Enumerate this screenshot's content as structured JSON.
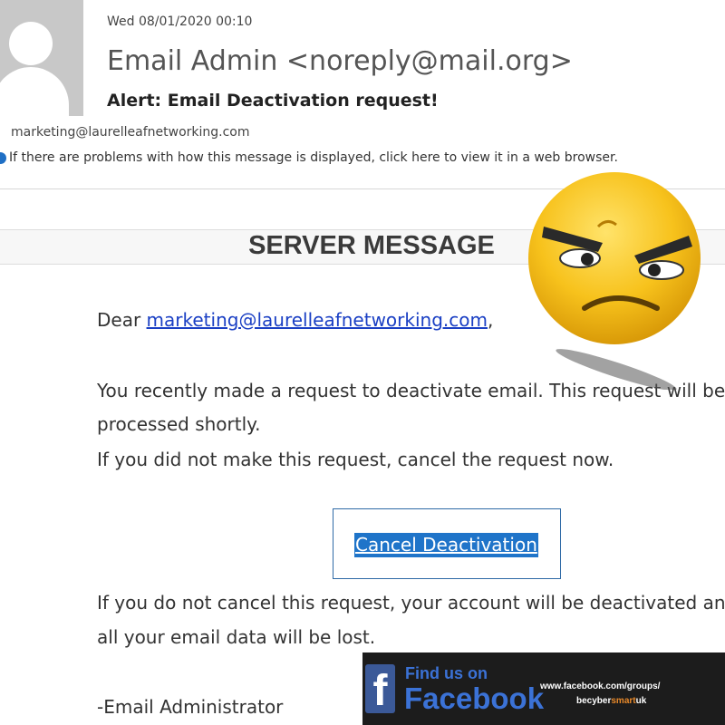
{
  "header": {
    "date": "Wed 08/01/2020 00:10",
    "from": "Email Admin <noreply@mail.org>",
    "subject": "Alert: Email Deactivation request!",
    "to": "marketing@laurelleafnetworking.com",
    "info_bar": "If there are problems with how this message is displayed, click here to view it in a web browser."
  },
  "message": {
    "band_title": "SERVER MESSAGE",
    "greeting_prefix": "Dear ",
    "greeting_email": "marketing@laurelleafnetworking.com",
    "greeting_suffix": ",",
    "para1_line1": "You recently made a request to deactivate email. This request will be",
    "para1_line2": "processed shortly.",
    "para2": "If you did not make this request, cancel the request now.",
    "cancel_label": "Cancel Deactivation",
    "warning_line1": "If you do not cancel this request, your account will be deactivated and",
    "warning_line2": "all your email data will be lost.",
    "signature": "-Email Administrator"
  },
  "banner": {
    "find_us": "Find us on",
    "facebook": "Facebook",
    "url": "www.facebook.com/groups/",
    "group_prefix": "becyber",
    "group_smart": "smart",
    "group_suffix": "uk",
    "logo_letter": "f"
  },
  "icons": {
    "avatar": "avatar-placeholder-icon",
    "info": "info-icon",
    "emoji": "angry-face-emoji"
  },
  "colors": {
    "link": "#1a3fc4",
    "selection": "#1f74c9",
    "facebook_blue": "#3b5998",
    "emoji_yellow": "#f7c21c"
  }
}
